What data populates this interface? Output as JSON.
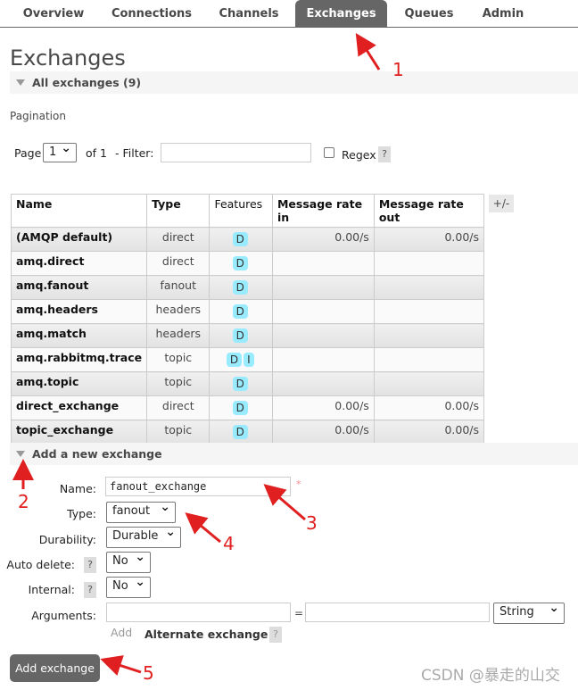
{
  "nav": {
    "tabs": [
      {
        "label": "Overview",
        "active": false
      },
      {
        "label": "Connections",
        "active": false
      },
      {
        "label": "Channels",
        "active": false
      },
      {
        "label": "Exchanges",
        "active": true
      },
      {
        "label": "Queues",
        "active": false
      },
      {
        "label": "Admin",
        "active": false
      }
    ]
  },
  "page_title": "Exchanges",
  "all_exchanges": {
    "label": "All exchanges (9)"
  },
  "pagination": {
    "label": "Pagination",
    "page_label": "Page",
    "page_value": "1",
    "of_label": "of 1",
    "filter_label": "- Filter:",
    "filter_value": "",
    "regex_label": "Regex",
    "regex_checked": false,
    "help": "?"
  },
  "table": {
    "columns": [
      "Name",
      "Type",
      "Features",
      "Message rate in",
      "Message rate out"
    ],
    "toggle_columns": "+/-",
    "rows": [
      {
        "name": "(AMQP default)",
        "type": "direct",
        "features": [
          "D"
        ],
        "rate_in": "0.00/s",
        "rate_out": "0.00/s"
      },
      {
        "name": "amq.direct",
        "type": "direct",
        "features": [
          "D"
        ],
        "rate_in": "",
        "rate_out": ""
      },
      {
        "name": "amq.fanout",
        "type": "fanout",
        "features": [
          "D"
        ],
        "rate_in": "",
        "rate_out": ""
      },
      {
        "name": "amq.headers",
        "type": "headers",
        "features": [
          "D"
        ],
        "rate_in": "",
        "rate_out": ""
      },
      {
        "name": "amq.match",
        "type": "headers",
        "features": [
          "D"
        ],
        "rate_in": "",
        "rate_out": ""
      },
      {
        "name": "amq.rabbitmq.trace",
        "type": "topic",
        "features": [
          "D",
          "I"
        ],
        "rate_in": "",
        "rate_out": ""
      },
      {
        "name": "amq.topic",
        "type": "topic",
        "features": [
          "D"
        ],
        "rate_in": "",
        "rate_out": ""
      },
      {
        "name": "direct_exchange",
        "type": "direct",
        "features": [
          "D"
        ],
        "rate_in": "0.00/s",
        "rate_out": "0.00/s"
      },
      {
        "name": "topic_exchange",
        "type": "topic",
        "features": [
          "D"
        ],
        "rate_in": "0.00/s",
        "rate_out": "0.00/s"
      }
    ]
  },
  "add_exchange": {
    "header": "Add a new exchange",
    "name_label": "Name:",
    "name_value": "fanout_exchange",
    "required_mark": "*",
    "type_label": "Type:",
    "type_value": "fanout",
    "durability_label": "Durability:",
    "durability_value": "Durable",
    "auto_delete_label": "Auto delete:",
    "auto_delete_value": "No",
    "internal_label": "Internal:",
    "internal_value": "No",
    "arguments_label": "Arguments:",
    "arg_key": "",
    "arg_equals": "=",
    "arg_value": "",
    "arg_type": "String",
    "add_link": "Add",
    "alternate_exchange": "Alternate exchange",
    "help": "?",
    "submit": "Add exchange"
  },
  "annotations": [
    "1",
    "2",
    "3",
    "4",
    "5"
  ],
  "annotation_color": "#e02020",
  "active_tab_color": "#666666",
  "badge_color": "#99ebff",
  "watermark": "CSDN @暴走的山交"
}
